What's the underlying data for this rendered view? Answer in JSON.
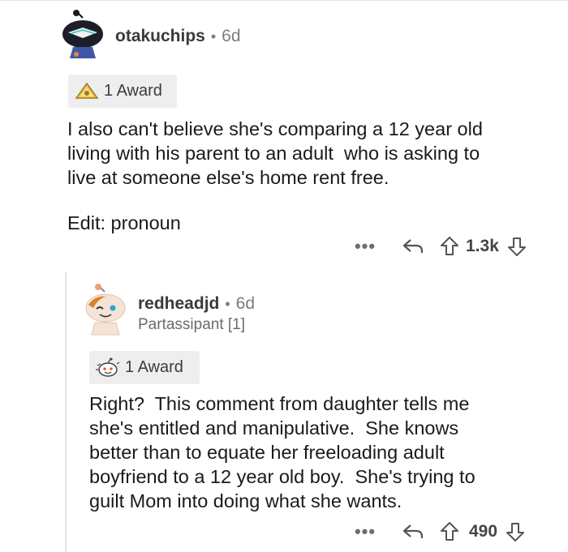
{
  "comments": [
    {
      "username": "otakuchips",
      "separator": "•",
      "age": "6d",
      "award_label": "1 Award",
      "body": [
        "I also can't believe she's comparing a 12 year old",
        "living with his parent to an adult  who is asking to",
        "live at someone else's home rent free.",
        "",
        "Edit: pronoun"
      ],
      "more_label": "•••",
      "score": "1.3k"
    },
    {
      "username": "redheadjd",
      "separator": "•",
      "age": "6d",
      "flair": "Partassipant [1]",
      "award_label": "1 Award",
      "body": [
        "Right?  This comment from daughter tells me",
        "she's entitled and manipulative.  She knows",
        "better than to equate her freeloading adult",
        "boyfriend to a 12 year old boy.  She's trying to",
        "guilt Mom into doing what she wants."
      ],
      "more_label": "•••",
      "score": "490"
    }
  ],
  "colors": {
    "background": "#ffffff",
    "chip_background": "#eeeeee",
    "thread_line": "#e6e6e6",
    "text": "#1a1a1b",
    "meta": "#7c7c7c"
  },
  "icons": [
    "avatar-snoo-visor",
    "award-silver-icon",
    "avatar-snoo-wink",
    "award-wholesome-icon",
    "reply-icon",
    "upvote-icon",
    "downvote-icon"
  ]
}
